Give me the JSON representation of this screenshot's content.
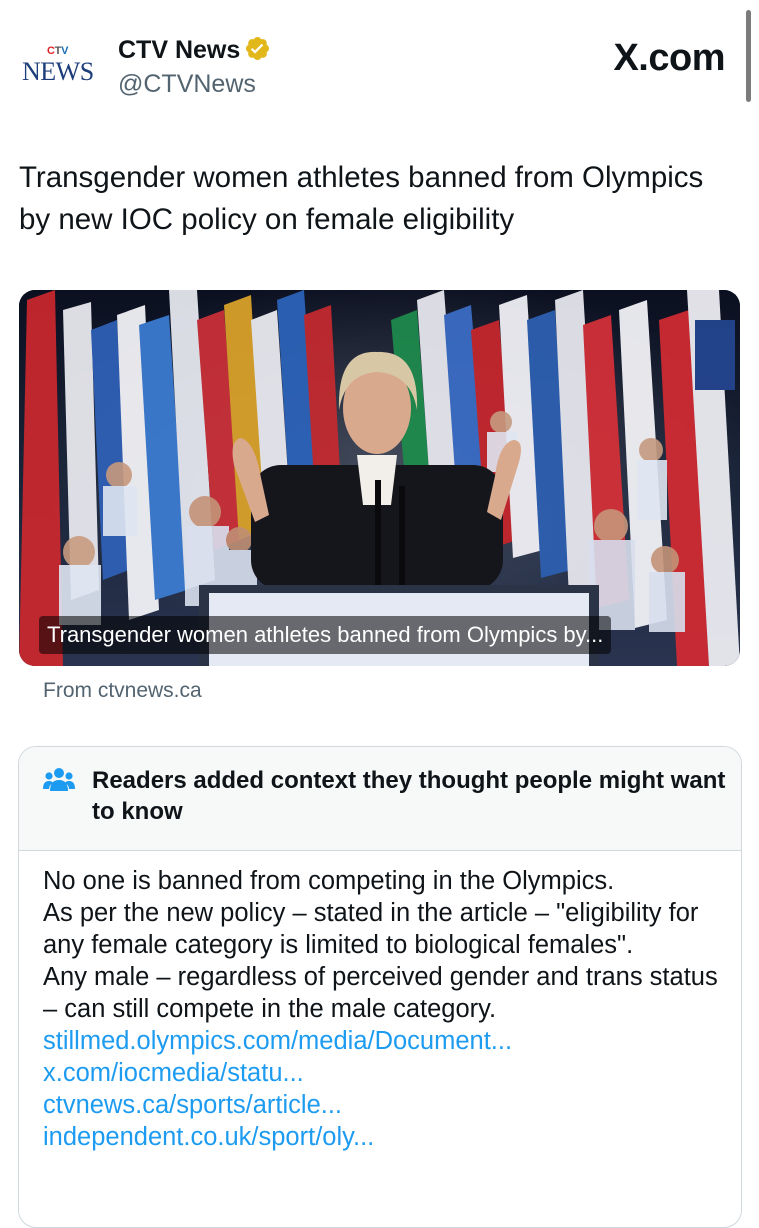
{
  "tweet": {
    "logo": {
      "top": [
        "C",
        "T",
        "V"
      ],
      "bottom": "NEWS"
    },
    "account_name": "CTV News",
    "handle": "@CTVNews",
    "brand": "X.com",
    "headline": "Transgender women athletes banned from Olympics by new IOC policy on female eligibility",
    "media_caption": "Transgender women athletes banned from Olympics by...",
    "source": "From ctvnews.ca"
  },
  "community_note": {
    "title": "Readers added context they thought people might want to know",
    "body": [
      "No one is banned from competing in the Olympics.",
      "As per the new policy – stated in the article – \"eligibility for any female category is limited to biological females\".",
      "Any male – regardless of perceived gender and trans status – can still compete in the male category."
    ],
    "links": [
      "stillmed.olympics.com/media/Document...",
      "x.com/iocmedia/statu...",
      "ctvnews.ca/sports/article...",
      "independent.co.uk/sport/oly..."
    ]
  },
  "colors": {
    "link": "#1d9bf0",
    "verified_badge": "#e2b719",
    "secondary_text": "#536471",
    "note_header_bg": "#f7f9f9"
  }
}
